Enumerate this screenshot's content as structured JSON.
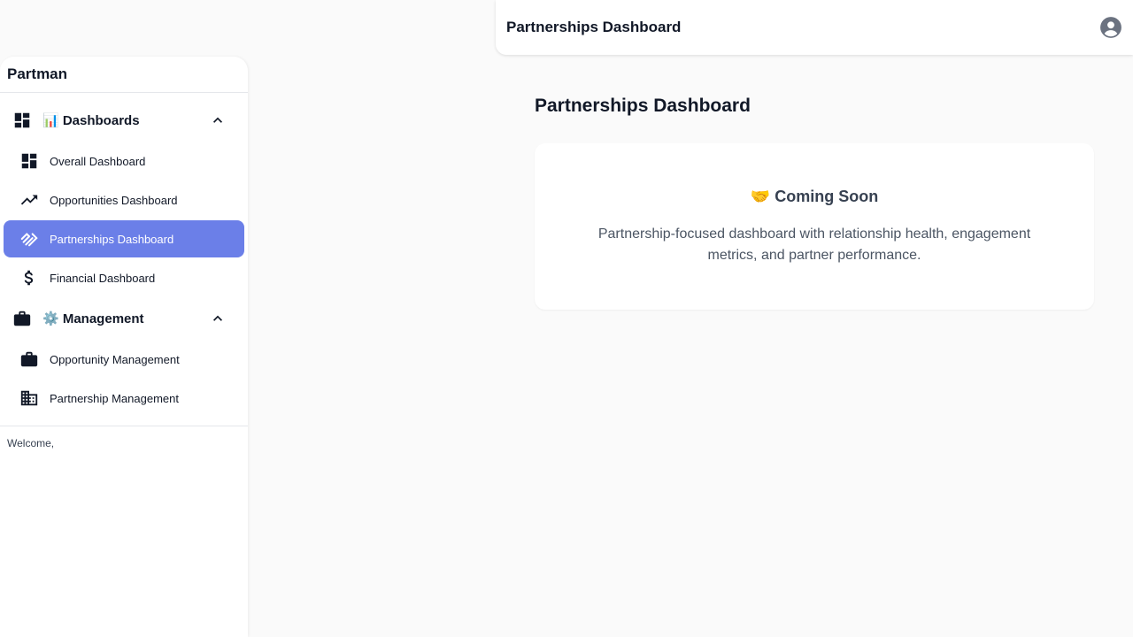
{
  "topbar": {
    "title": "Partnerships Dashboard",
    "account_icon": "account-circle-icon"
  },
  "sidebar": {
    "brand": "Partman",
    "sections": [
      {
        "label": "📊 Dashboards",
        "icon": "dashboard-icon",
        "expanded": true,
        "items": [
          {
            "label": "Overall Dashboard",
            "icon": "dashboard-icon"
          },
          {
            "label": "Opportunities Dashboard",
            "icon": "trending-up-icon"
          },
          {
            "label": "Partnerships Dashboard",
            "icon": "handshake-icon",
            "active": true
          },
          {
            "label": "Financial Dashboard",
            "icon": "dollar-icon"
          }
        ]
      },
      {
        "label": "⚙️ Management",
        "icon": "briefcase-icon",
        "expanded": true,
        "items": [
          {
            "label": "Opportunity Management",
            "icon": "briefcase-icon"
          },
          {
            "label": "Partnership Management",
            "icon": "building-icon"
          }
        ]
      }
    ],
    "footer_text": "Welcome,"
  },
  "main": {
    "page_title": "Partnerships Dashboard",
    "card": {
      "title": "🤝 Coming Soon",
      "description": "Partnership-focused dashboard with relationship health, engagement metrics, and partner performance."
    }
  },
  "colors": {
    "active_bg": "#6b7fe8",
    "text_dark": "#111827",
    "background": "#fafafa"
  }
}
